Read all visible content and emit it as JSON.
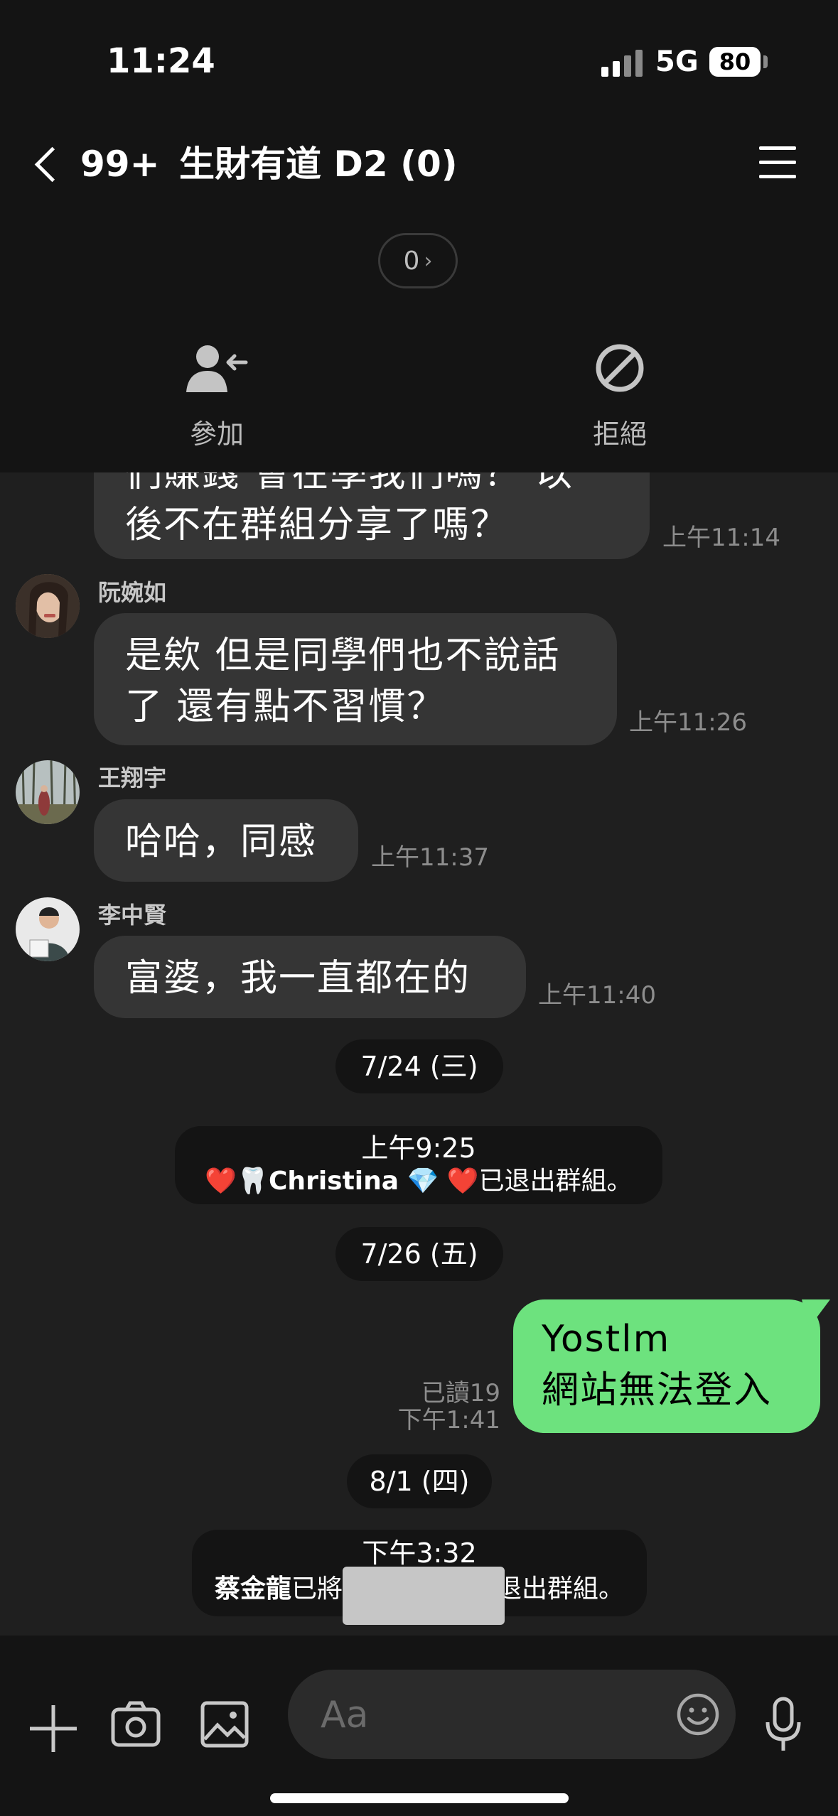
{
  "status": {
    "time": "11:24",
    "network": "5G",
    "battery": "80"
  },
  "header": {
    "back_count": "99+",
    "title": "生財有道 D2 (0)",
    "member_count": "0"
  },
  "actions": {
    "join": "參加",
    "reject": "拒絕"
  },
  "messages": {
    "m1": {
      "text_line1": "們賺錢 會在學我們嗎？ 以",
      "text_line2": "後不在群組分享了嗎？",
      "time": "上午11:14"
    },
    "m2": {
      "name": "阮婉如",
      "text_line1": "是欸 但是同學們也不說話",
      "text_line2": "了 還有點不習慣？",
      "time": "上午11:26"
    },
    "m3": {
      "name": "王翔宇",
      "text": "哈哈，同感",
      "time": "上午11:37"
    },
    "m4": {
      "name": "李中賢",
      "text": "富婆，我一直都在的",
      "time": "上午11:40"
    },
    "date1": "7/24 (三)",
    "sys1": {
      "time": "上午9:25",
      "emoji_prefix": "❤️🦷",
      "user": "Christina",
      "emoji_suffix": "💎 ❤️",
      "text": "已退出群組。"
    },
    "date2": "7/26 (五)",
    "mine": {
      "read": "已讀19",
      "time": "下午1:41",
      "line1": "Yostlm",
      "line2": "網站無法登入"
    },
    "date3": "8/1 (四)",
    "sys2": {
      "time": "下午3:32",
      "user": "蔡金龍",
      "text_pre": "已將",
      "text_post": "退出群組。"
    }
  },
  "input": {
    "placeholder": "Aa"
  }
}
